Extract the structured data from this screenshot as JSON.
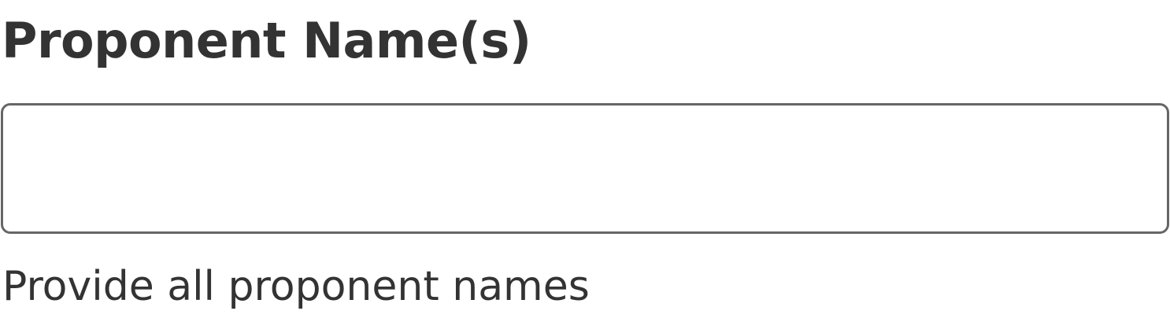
{
  "form": {
    "proponent_names": {
      "label": "Proponent Name(s)",
      "value": "",
      "hint": "Provide all proponent names"
    }
  },
  "colors": {
    "text": "#333333",
    "border": "#666666",
    "background": "#ffffff"
  }
}
